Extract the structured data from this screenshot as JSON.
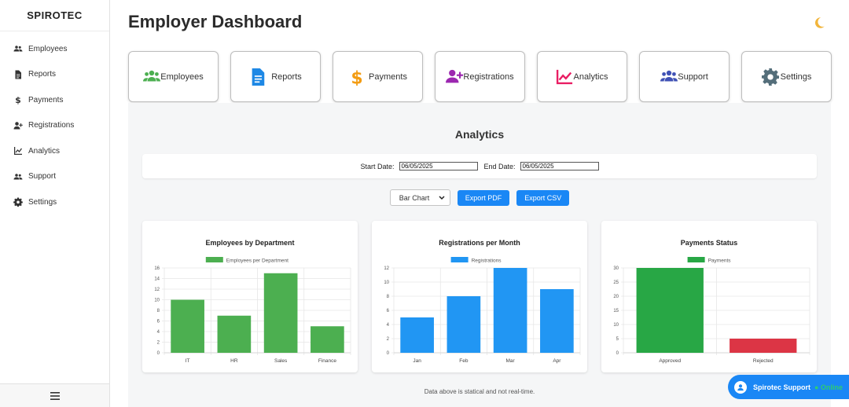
{
  "brand": "SPIROTEC",
  "sidebar": {
    "items": [
      {
        "label": "Employees",
        "icon": "users-icon"
      },
      {
        "label": "Reports",
        "icon": "file-icon"
      },
      {
        "label": "Payments",
        "icon": "dollar-icon"
      },
      {
        "label": "Registrations",
        "icon": "user-plus-icon"
      },
      {
        "label": "Analytics",
        "icon": "chart-line-icon"
      },
      {
        "label": "Support",
        "icon": "users-icon"
      },
      {
        "label": "Settings",
        "icon": "gear-icon"
      }
    ],
    "footer_icon": "menu-icon"
  },
  "header": {
    "title": "Employer Dashboard",
    "theme_icon": "moon-icon"
  },
  "cards": [
    {
      "label": "Employees",
      "icon": "users-icon",
      "color": "#4caf50"
    },
    {
      "label": "Reports",
      "icon": "file-icon",
      "color": "#1e88e5"
    },
    {
      "label": "Payments",
      "icon": "dollar-icon",
      "color": "#f39c12"
    },
    {
      "label": "Registrations",
      "icon": "user-plus-icon",
      "color": "#9c27b0"
    },
    {
      "label": "Analytics",
      "icon": "chart-line-icon",
      "color": "#e91e63"
    },
    {
      "label": "Support",
      "icon": "users-icon",
      "color": "#3f51b5"
    },
    {
      "label": "Settings",
      "icon": "gear-icon",
      "color": "#546e7a"
    }
  ],
  "analytics": {
    "title": "Analytics",
    "start_label": "Start Date:",
    "start_value": "06/05/2025",
    "end_label": "End Date:",
    "end_value": "06/05/2025",
    "chart_type_selected": "Bar Chart",
    "export_pdf": "Export PDF",
    "export_csv": "Export CSV",
    "footnote": "Data above is statical and not real-time."
  },
  "support_widget": {
    "label": "Spirotec Support",
    "status": "Online",
    "status_dot": "●"
  },
  "chart_data": [
    {
      "type": "bar",
      "title": "Employees by Department",
      "categories": [
        "IT",
        "HR",
        "Sales",
        "Finance"
      ],
      "series": [
        {
          "name": "Employees per Department",
          "values": [
            10,
            7,
            15,
            5
          ],
          "color": "#4caf50"
        }
      ],
      "ylim": [
        0,
        16
      ],
      "yticks": [
        0,
        2,
        4,
        6,
        8,
        10,
        12,
        14,
        16
      ],
      "grid": true,
      "legend": "top"
    },
    {
      "type": "bar",
      "title": "Registrations per Month",
      "categories": [
        "Jan",
        "Feb",
        "Mar",
        "Apr"
      ],
      "series": [
        {
          "name": "Registrations",
          "values": [
            5,
            8,
            12,
            9
          ],
          "color": "#2196f3"
        }
      ],
      "ylim": [
        0,
        12
      ],
      "yticks": [
        0,
        2,
        4,
        6,
        8,
        10,
        12
      ],
      "grid": true,
      "legend": "top"
    },
    {
      "type": "bar",
      "title": "Payments Status",
      "categories": [
        "Approved",
        "Rejected"
      ],
      "series": [
        {
          "name": "Payments",
          "values": [
            30,
            5
          ],
          "colors": [
            "#28a745",
            "#dc3545"
          ],
          "color": "#28a745"
        }
      ],
      "ylim": [
        0,
        30
      ],
      "yticks": [
        0,
        5,
        10,
        15,
        20,
        25,
        30
      ],
      "grid": true,
      "legend": "top"
    }
  ]
}
